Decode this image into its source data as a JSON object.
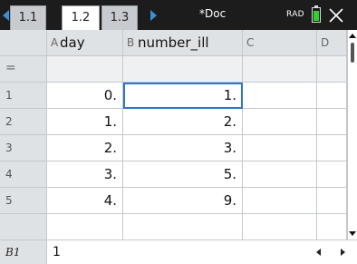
{
  "topbar": {
    "tabs": [
      {
        "label": "1.1",
        "active": false
      },
      {
        "label": "1.2",
        "active": true
      },
      {
        "label": "1.3",
        "active": false
      }
    ],
    "document_title": "*Doc",
    "angle_mode": "RAD",
    "colors": {
      "bar": "#1c1c1c",
      "arrow": "#3b8fd9",
      "battery": "#2fd12f"
    }
  },
  "sheet": {
    "columns": [
      {
        "letter": "A",
        "name": "day"
      },
      {
        "letter": "B",
        "name": "number_ill"
      },
      {
        "letter": "C",
        "name": ""
      },
      {
        "letter": "D",
        "name": ""
      }
    ],
    "formula_row_label": "=",
    "rows": [
      {
        "num": "1",
        "a": "0.",
        "b": "1."
      },
      {
        "num": "2",
        "a": "1.",
        "b": "2."
      },
      {
        "num": "3",
        "a": "2.",
        "b": "3."
      },
      {
        "num": "4",
        "a": "3.",
        "b": "5."
      },
      {
        "num": "5",
        "a": "4.",
        "b": "9."
      }
    ],
    "selected_cell": "B1",
    "selection_color": "#2f76c6"
  },
  "entry_line": {
    "cell_ref": "B1",
    "value": "1"
  }
}
